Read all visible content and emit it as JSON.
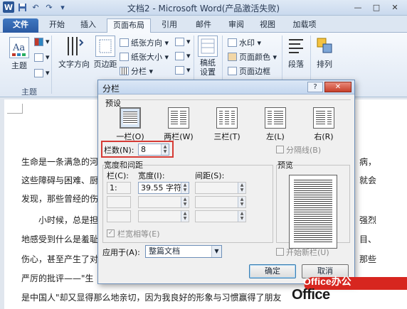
{
  "window": {
    "title": "文档2 - Microsoft Word(产品激活失败)",
    "word_logo": "W",
    "undo": "↶",
    "redo": "↷",
    "minimize": "—",
    "maximize": "□",
    "close": "✕"
  },
  "tabs": [
    "文件",
    "开始",
    "插入",
    "页面布局",
    "引用",
    "邮件",
    "审阅",
    "视图",
    "加载项"
  ],
  "active_tab": "页面布局",
  "ribbon": {
    "theme_group": {
      "theme_label": "主题",
      "group_label": "主题"
    },
    "text_direction": "文字方向",
    "margins": "页边距",
    "orientation": "纸张方向 ▾",
    "size": "纸张大小 ▾",
    "columns": "分栏 ▾",
    "draft_label": "稿纸\n设置",
    "watermark": "水印 ▾",
    "page_color": "页面颜色 ▾",
    "page_border": "页面边框",
    "paragraph": "段落",
    "arrange": "排列"
  },
  "document": {
    "lines": [
      "生命是一条满急的河",
      "这些障碍与困难、厨",
      "发现，那些曾经的伤",
      "小时候，总是担",
      "地感受到什么是羞耻",
      "伤心，甚至产生了对",
      "严厉的批评——\"生",
      "是中国人\"却又显得那么地亲切，因为我良好的形象与习惯赢得了朋友"
    ],
    "right_fragments": [
      "病，",
      "就会",
      "强烈",
      "目、",
      "那些"
    ]
  },
  "dialog": {
    "title": "分栏",
    "help": "?",
    "close": "✕",
    "presets_label": "预设",
    "presets": [
      "一栏(O)",
      "两栏(W)",
      "三栏(T)",
      "左(L)",
      "右(R)"
    ],
    "columns_label": "栏数(N):",
    "columns_value": "8",
    "line_between_label": "分隔线(B)",
    "width_spacing_label": "宽度和间距",
    "preview_label": "预览",
    "col_header": "栏(C):",
    "width_header": "宽度(I):",
    "spacing_header": "间距(S):",
    "row1_col": "1:",
    "row1_width": "39.55 字符",
    "equal_width_label": "栏宽相等(E)",
    "equal_width_checked": "✓",
    "apply_to_label": "应用于(A):",
    "apply_to_value": "整篇文档",
    "start_new_col_label": "开始新栏(U)",
    "ok": "确定",
    "cancel": "取消"
  },
  "watermark": {
    "brand_top": "Office办公",
    "brand": "Office"
  }
}
